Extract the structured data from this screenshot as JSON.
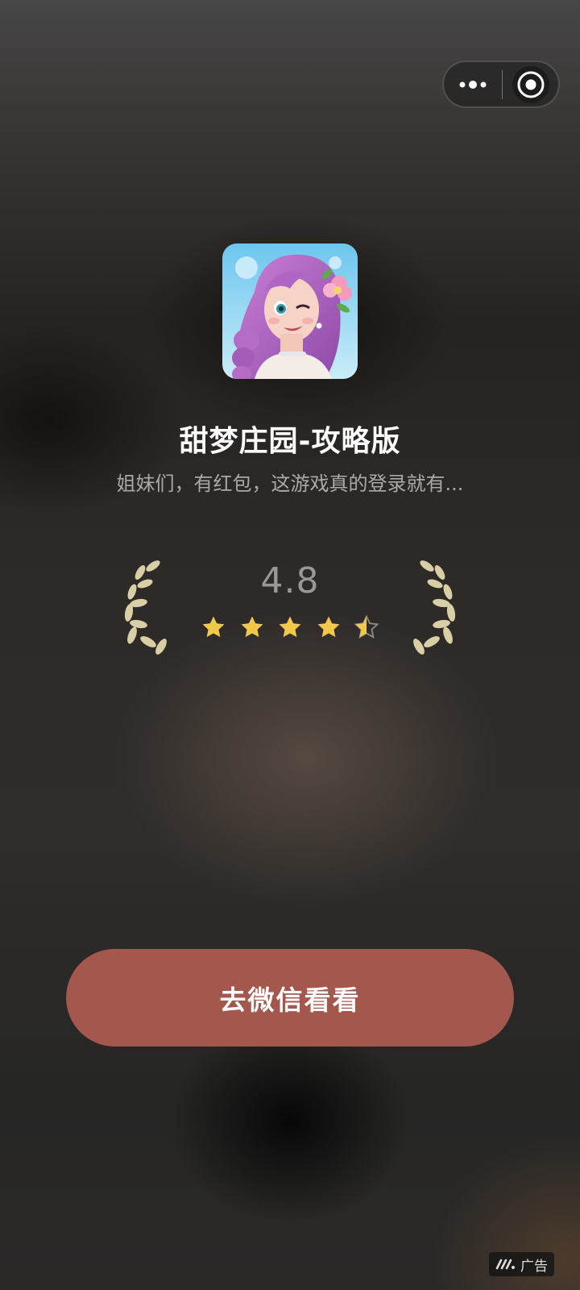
{
  "capsule": {
    "more_icon": "more-dots-icon",
    "close_icon": "target-close-icon"
  },
  "app": {
    "icon": "app-icon-girl-with-flower",
    "title": "甜梦庄园-攻略版",
    "description": "姐妹们，有红包，这游戏真的登录就有..."
  },
  "rating": {
    "score": "4.8",
    "stars_full": 4,
    "stars_half": 1,
    "stars_total": 5,
    "star_color": "#f2c84b"
  },
  "cta": {
    "label": "去微信看看",
    "color": "#a4574d"
  },
  "ad_badge": {
    "label": "广告",
    "icon": "ad-logo-icon"
  }
}
